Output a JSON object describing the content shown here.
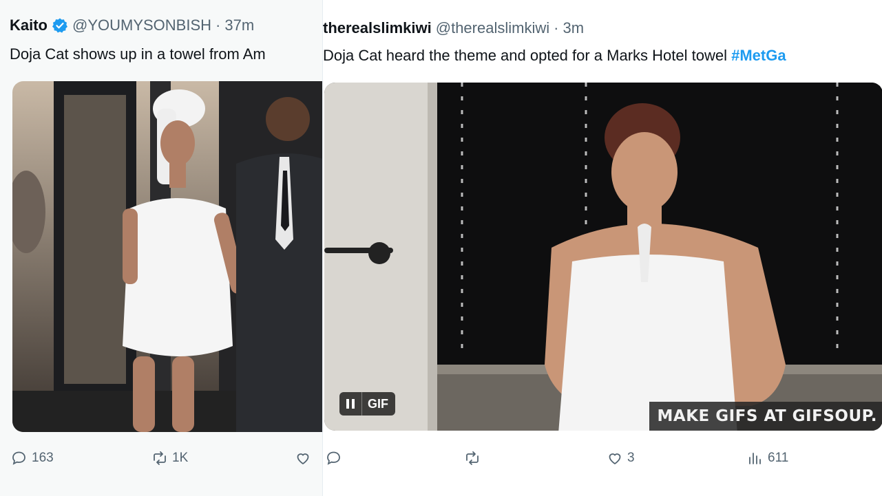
{
  "left_tweet": {
    "display_name": "Kaito",
    "handle": "@YOUMYSONBISH",
    "separator": "·",
    "time": "37m",
    "text": "Doja Cat shows up in a towel from Am",
    "media": {
      "icon": "photo"
    },
    "actions": {
      "replies": "163",
      "retweets": "1K",
      "likes": ""
    }
  },
  "right_tweet": {
    "display_name": "therealslimkiwi",
    "handle": "@therealslimkiwi",
    "separator": "·",
    "time": "3m",
    "text": "Doja Cat heard the theme and opted for a Marks Hotel towel ",
    "hashtag": "#MetGa",
    "media": {
      "gif_label": "GIF",
      "watermark": "MAKE GIFS AT GIFSOUP."
    },
    "actions": {
      "replies": "",
      "retweets": "",
      "likes": "3",
      "views": "611"
    }
  },
  "colors": {
    "text_primary": "#0f1419",
    "text_secondary": "#536471",
    "accent": "#1d9bf0"
  }
}
